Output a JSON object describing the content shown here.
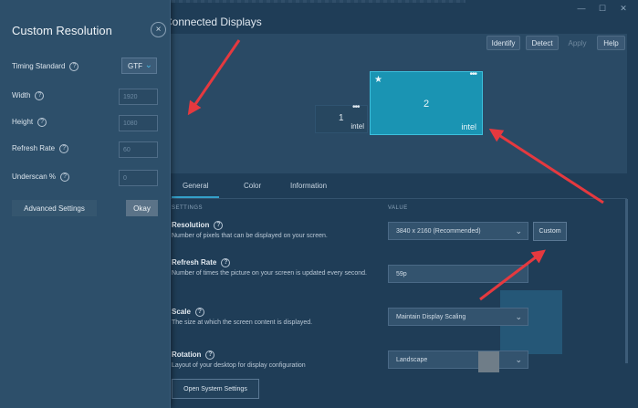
{
  "window": {
    "title": "Connected Displays",
    "controls": [
      "—",
      "☐",
      "✕"
    ]
  },
  "toolbar": {
    "identify": "Identify",
    "detect": "Detect",
    "apply": "Apply",
    "help": "Help"
  },
  "displays": [
    {
      "number": "1",
      "brand": "intel",
      "menu": "•••"
    },
    {
      "number": "2",
      "brand": "intel",
      "menu": "•••",
      "primary_icon": "★"
    }
  ],
  "tabs": [
    {
      "label": "General",
      "active": true
    },
    {
      "label": "Color",
      "active": false
    },
    {
      "label": "Information",
      "active": false
    }
  ],
  "columns": {
    "settings": "SETTINGS",
    "value": "VALUE"
  },
  "settings": {
    "resolution": {
      "title": "Resolution",
      "desc": "Number of pixels that can be displayed on your screen.",
      "value": "3840 x 2160 (Recommended)",
      "custom_label": "Custom"
    },
    "refresh": {
      "title": "Refresh Rate",
      "desc": "Number of times the picture on your screen is updated every second.",
      "value": "59p"
    },
    "scale": {
      "title": "Scale",
      "desc": "The size at which the screen content is displayed.",
      "value": "Maintain Display Scaling"
    },
    "rotation": {
      "title": "Rotation",
      "desc": "Layout of your desktop for display configuration",
      "value": "Landscape"
    }
  },
  "open_system_settings": "Open System Settings",
  "dialog": {
    "title": "Custom Resolution",
    "close": "×",
    "timing_label": "Timing Standard",
    "timing_value": "GTF",
    "width_label": "Width",
    "width_value": "1920",
    "height_label": "Height",
    "height_value": "1080",
    "refresh_label": "Refresh Rate",
    "refresh_value": "60",
    "underscan_label": "Underscan %",
    "underscan_value": "0",
    "advanced": "Advanced Settings",
    "okay": "Okay"
  },
  "help_glyph": "?",
  "chevron": "⌄",
  "colors": {
    "accent": "#1a94b3",
    "annotation_arrow": "#e5393f",
    "panel": "#2d4f6a",
    "background": "#1f3d57"
  }
}
